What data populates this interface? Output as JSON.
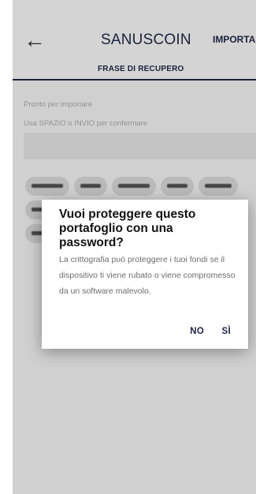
{
  "header": {
    "back_icon": "arrow-left-icon",
    "title": "SANUSCOIN",
    "import_label": "IMPORTA"
  },
  "tabs": [
    {
      "label": "FRASE DI RECUPERO"
    }
  ],
  "content": {
    "status": "Pronto per importare",
    "instruction": "Usa SPAZIO o INVIO per confermare",
    "input_value": ""
  },
  "dialog": {
    "title": "Vuoi proteggere questo portafoglio con una password?",
    "body": "La crittografia può proteggere i tuoi fondi se il dispositivo ti viene rubato o viene compromesso da un software malevolo.",
    "no_label": "NO",
    "yes_label": "SÌ"
  },
  "colors": {
    "accent": "#1d2340",
    "background": "#dcdcdc",
    "dialog": "#ffffff"
  }
}
